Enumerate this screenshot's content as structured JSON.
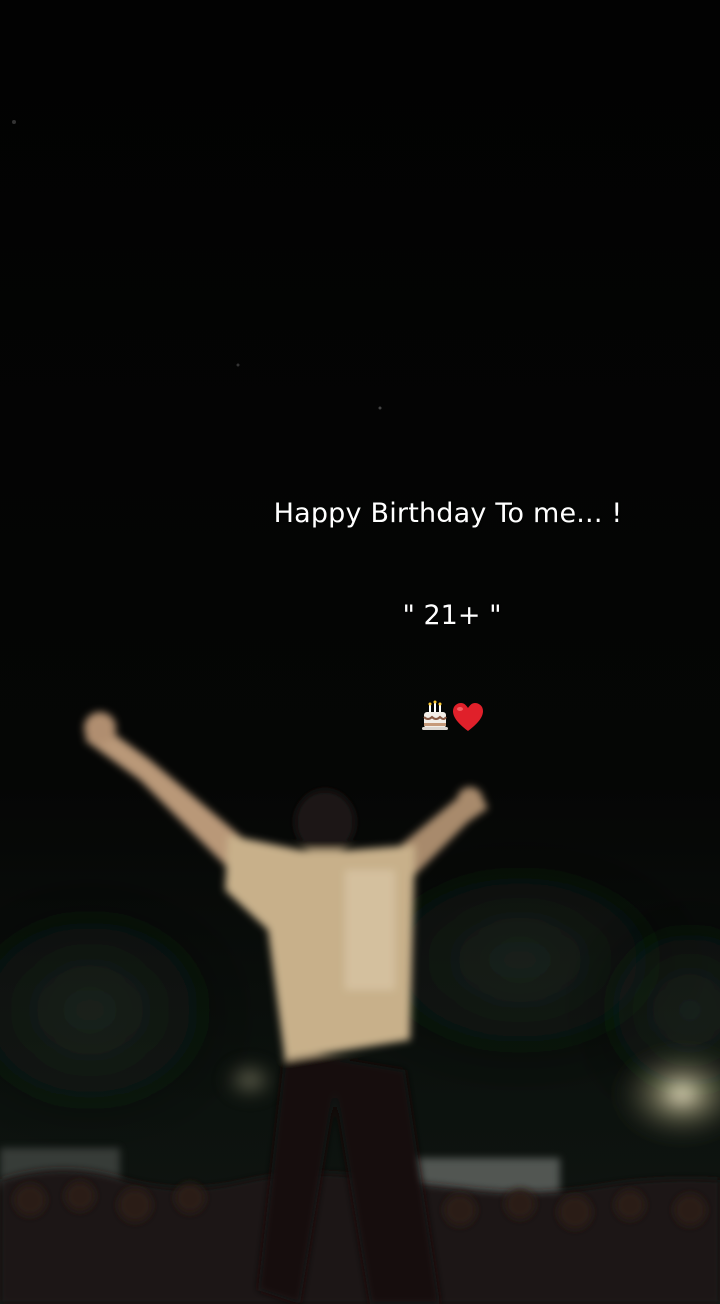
{
  "caption": {
    "line1": "Happy Birthday To me... !",
    "line2": "\" 21+ \""
  },
  "emojis": [
    "birthday-cake",
    "red-heart"
  ],
  "colors": {
    "background": "#000000",
    "text": "#ffffff",
    "heart": "#e0202a",
    "shirt": "#c8b08a"
  }
}
